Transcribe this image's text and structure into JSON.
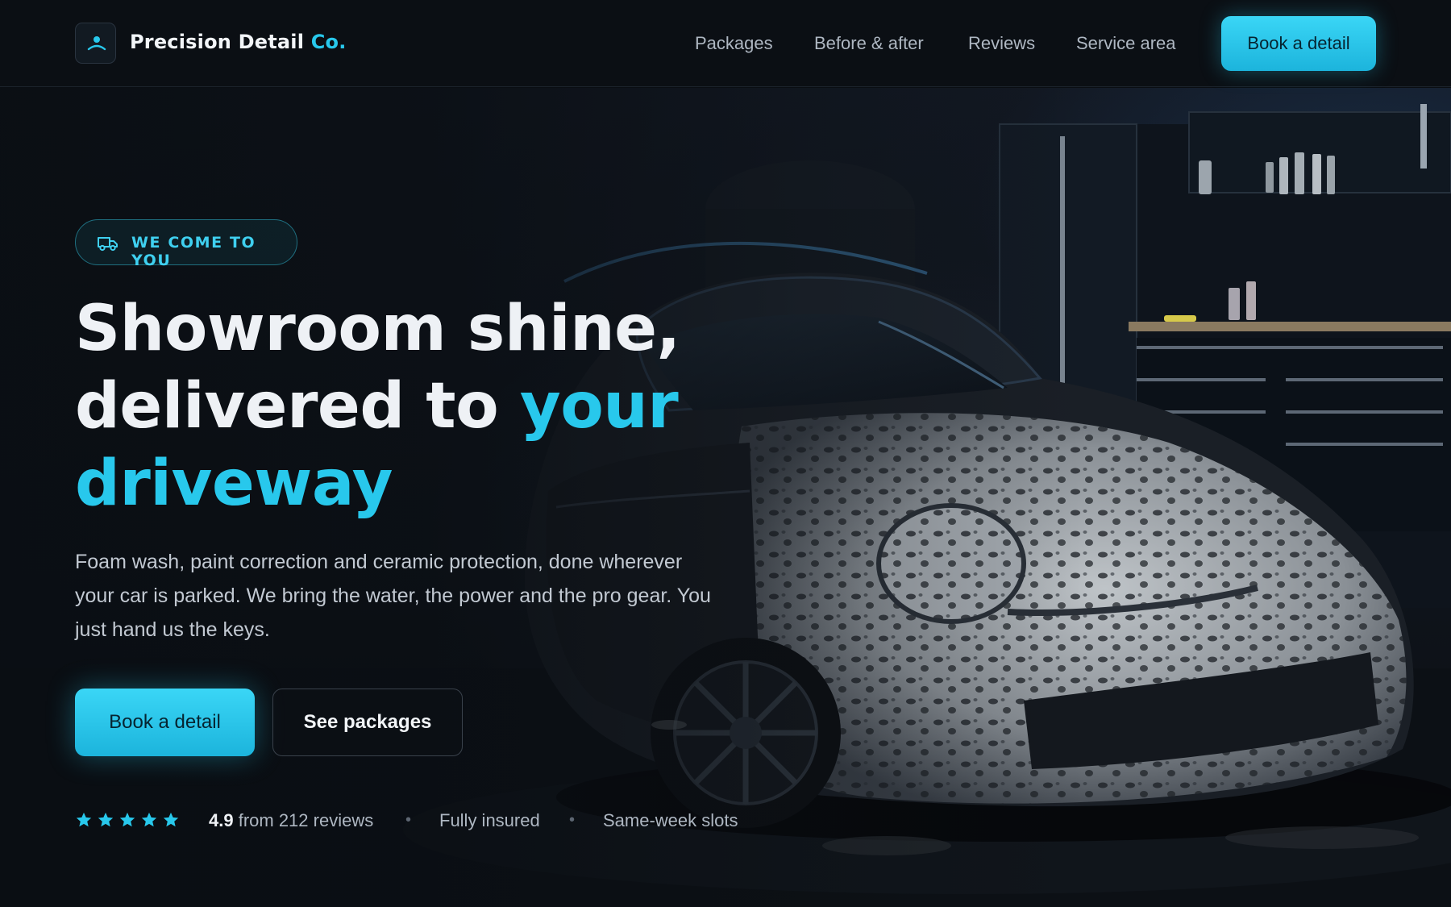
{
  "header": {
    "brand_name": "Precision Detail",
    "brand_accent": "Co.",
    "nav": [
      "Packages",
      "Before & after",
      "Reviews",
      "Service area"
    ],
    "cta": "Book a detail"
  },
  "hero": {
    "eyebrow": "WE COME TO YOU",
    "headline_line1": "Showroom shine,",
    "headline_line2": "delivered to ",
    "headline_highlight_1": "your",
    "headline_highlight_2": "driveway",
    "subtext": "Foam wash, paint correction and ceramic protection, done wherever your car is parked. We bring the water, the power and the pro gear. You just hand us the keys.",
    "primary_cta": "Book a detail",
    "secondary_cta": "See packages",
    "rating_stars": 5,
    "rating_value": "4.9",
    "rating_text": " from 212 reviews",
    "trust_1": "Fully insured",
    "trust_2": "Same-week slots",
    "separator": "•"
  },
  "icons": {
    "logo": "person-icon",
    "eyebrow": "truck-icon",
    "rating": "star-icon"
  },
  "colors": {
    "accent": "#28c8ec",
    "background": "#0a0e13",
    "button_text": "#062430"
  }
}
